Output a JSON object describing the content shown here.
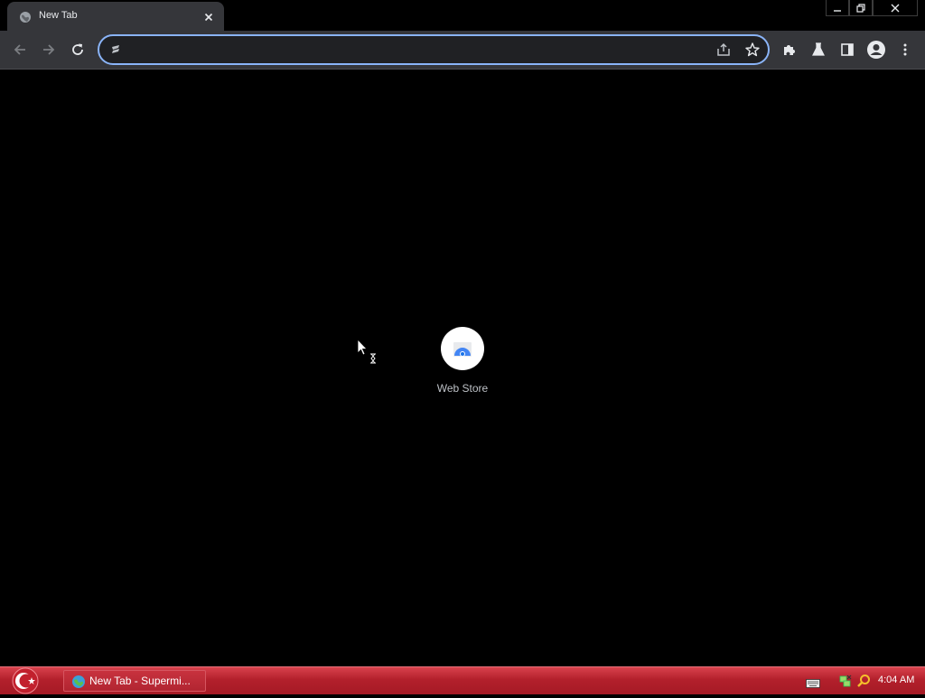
{
  "browser": {
    "tab": {
      "title": "New Tab",
      "favicon": "globe-icon",
      "close_icon": "close-icon"
    },
    "window_controls": [
      "minimize-icon",
      "restore-icon",
      "close-icon"
    ],
    "toolbar": {
      "buttons": [
        "back-arrow-icon",
        "forward-arrow-icon",
        "reload-icon"
      ],
      "omnibox": {
        "value": "",
        "placeholder": "",
        "site_icon": "site-info-icon"
      },
      "omnibox_actions": [
        "share-icon",
        "bookmark-star-icon"
      ],
      "right_buttons": [
        "extensions-puzzle-icon",
        "labs-flask-icon",
        "side-panel-icon",
        "profile-avatar-icon",
        "menu-dots-icon"
      ]
    },
    "colors": {
      "frame": "#000000",
      "toolbar": "#35363a",
      "focus_ring": "#8ab4f8",
      "page_bg": "#000000"
    }
  },
  "new_tab_page": {
    "shortcuts": [
      {
        "label": "Web Store",
        "icon": "web-store-icon"
      }
    ]
  },
  "taskbar": {
    "start_icon": "start-orb-icon",
    "items": [
      {
        "label": "New Tab - Supermi...",
        "icon": "browser-globe-icon"
      }
    ],
    "tray": [
      "keyboard-icon",
      "network-icon",
      "search-icon"
    ],
    "clock": "4:04 AM",
    "colors": {
      "bar": "#b3202c"
    }
  }
}
